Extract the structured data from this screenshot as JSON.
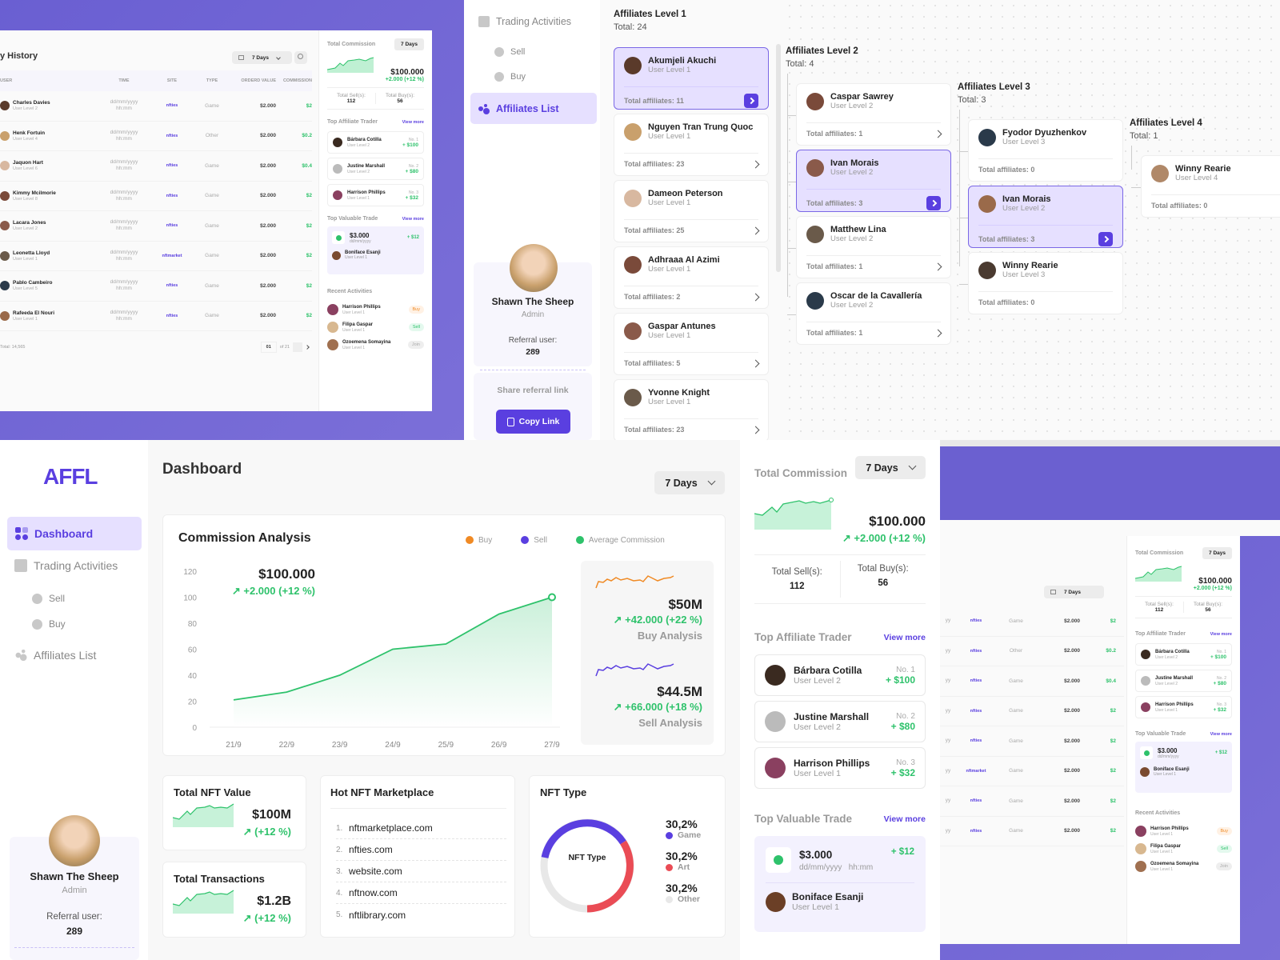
{
  "colors": {
    "accent": "#5a3fe0",
    "green": "#2ec26b",
    "orange": "#f08a24",
    "red": "#ea4c55",
    "bg_purple": "#6b60d0"
  },
  "history": {
    "title": "y History",
    "range": "7 Days",
    "columns": [
      "USER",
      "TIME",
      "SITE",
      "TYPE",
      "ORDERD VALUE",
      "COMMISSION"
    ],
    "rows": [
      {
        "name": "Charles Davies",
        "level": "User Level 2",
        "date": "dd/mm/yyyy",
        "time": "hh:mm",
        "site": "nfties",
        "type": "Game",
        "value": "$2.000",
        "commission": "$2"
      },
      {
        "name": "Henk Fortuin",
        "level": "User Level 4",
        "date": "dd/mm/yyyy",
        "time": "hh:mm",
        "site": "nfties",
        "type": "Other",
        "value": "$2.000",
        "commission": "$0.2"
      },
      {
        "name": "Jaquon Hart",
        "level": "User Level 6",
        "date": "dd/mm/yyyy",
        "time": "hh:mm",
        "site": "nfties",
        "type": "Game",
        "value": "$2.000",
        "commission": "$0.4"
      },
      {
        "name": "Kimmy Mcilmorie",
        "level": "User Level 8",
        "date": "dd/mm/yyyy",
        "time": "hh:mm",
        "site": "nfties",
        "type": "Game",
        "value": "$2.000",
        "commission": "$2"
      },
      {
        "name": "Lacara Jones",
        "level": "User Level 2",
        "date": "dd/mm/yyyy",
        "time": "hh:mm",
        "site": "nfties",
        "type": "Game",
        "value": "$2.000",
        "commission": "$2"
      },
      {
        "name": "Leonetta Lloyd",
        "level": "User Level 1",
        "date": "dd/mm/yyyy",
        "time": "hh:mm",
        "site": "nftmarket",
        "type": "Game",
        "value": "$2.000",
        "commission": "$2"
      },
      {
        "name": "Pablo Cambeiro",
        "level": "User Level 5",
        "date": "dd/mm/yyyy",
        "time": "hh:mm",
        "site": "nfties",
        "type": "Game",
        "value": "$2.000",
        "commission": "$2"
      },
      {
        "name": "Rafeeda El Nouri",
        "level": "User Level 1",
        "date": "dd/mm/yyyy",
        "time": "hh:mm",
        "site": "nfties",
        "type": "Game",
        "value": "$2.000",
        "commission": "$2"
      }
    ],
    "total": "Total: 14,565",
    "page": "01",
    "of_pages": "of 21"
  },
  "commission": {
    "title": "Total Commission",
    "range": "7 Days",
    "value": "$100.000",
    "change": "+2.000 (+12 %)",
    "sell_label": "Total Sell(s):",
    "sell_value": "112",
    "buy_label": "Total Buy(s):",
    "buy_value": "56"
  },
  "top_traders": {
    "title": "Top Affiliate Trader",
    "view_more": "View more",
    "items": [
      {
        "name": "Bárbara Cotilla",
        "level": "User Level 2",
        "rank": "No. 1",
        "amount": "+ $100"
      },
      {
        "name": "Justine Marshall",
        "level": "User Level 2",
        "rank": "No. 2",
        "amount": "+ $80"
      },
      {
        "name": "Harrison Phillips",
        "level": "User Level 1",
        "rank": "No. 3",
        "amount": "+ $32"
      }
    ]
  },
  "valuable_trade": {
    "title": "Top Valuable Trade",
    "view_more": "View more",
    "amount": "$3.000",
    "date": "dd/mm/yyyy",
    "time": "hh:mm",
    "gain": "+ $12",
    "user_name": "Boniface Esanji",
    "user_level": "User Level 1"
  },
  "recent": {
    "title": "Recent Activities",
    "items": [
      {
        "name": "Harrison Phillips",
        "level": "User Level 1",
        "badge": "Buy"
      },
      {
        "name": "Filipa Gaspar",
        "level": "User Level 1",
        "badge": "Sell"
      },
      {
        "name": "Ozoemena Somayina",
        "level": "User Level 1",
        "badge": "Join"
      }
    ]
  },
  "nav": {
    "logo": "AFFL",
    "dashboard": "Dashboard",
    "trading": "Trading Activities",
    "sell": "Sell",
    "buy": "Buy",
    "affiliates": "Affiliates List"
  },
  "profile": {
    "name": "Shawn The Sheep",
    "role": "Admin",
    "referral_label": "Referral user:",
    "referral_value": "289",
    "share_label": "Share referral link",
    "copy_button": "Copy Link"
  },
  "affiliates": {
    "levels": [
      {
        "title": "Affiliates Level 1",
        "total": "Total: 24",
        "items": [
          {
            "name": "Akumjeli Akuchi",
            "level": "User Level 1",
            "total": "Total affiliates: 11",
            "selected": true
          },
          {
            "name": "Nguyen Tran Trung Quoc",
            "level": "User Level 1",
            "total": "Total affiliates: 23"
          },
          {
            "name": "Dameon Peterson",
            "level": "User Level 1",
            "total": "Total affiliates: 25"
          },
          {
            "name": "Adhraaa Al Azimi",
            "level": "User Level 1",
            "total": "Total affiliates: 2"
          },
          {
            "name": "Gaspar Antunes",
            "level": "User Level 1",
            "total": "Total affiliates: 5"
          },
          {
            "name": "Yvonne Knight",
            "level": "User Level 1",
            "total": "Total affiliates: 23"
          }
        ]
      },
      {
        "title": "Affiliates Level 2",
        "total": "Total: 4",
        "items": [
          {
            "name": "Caspar Sawrey",
            "level": "User Level 2",
            "total": "Total affiliates: 1"
          },
          {
            "name": "Ivan Morais",
            "level": "User Level 2",
            "total": "Total affiliates: 3",
            "selected": true
          },
          {
            "name": "Matthew Lina",
            "level": "User Level 2",
            "total": "Total affiliates: 1"
          },
          {
            "name": "Oscar de la Cavallería",
            "level": "User Level 2",
            "total": "Total affiliates: 1"
          }
        ]
      },
      {
        "title": "Affiliates Level 3",
        "total": "Total: 3",
        "items": [
          {
            "name": "Fyodor Dyuzhenkov",
            "level": "User Level 3",
            "total": "Total affiliates: 0"
          },
          {
            "name": "Ivan Morais",
            "level": "User Level 2",
            "total": "Total affiliates: 3",
            "selected": true
          },
          {
            "name": "Winny Rearie",
            "level": "User Level 3",
            "total": "Total affiliates: 0"
          }
        ]
      },
      {
        "title": "Affiliates Level 4",
        "total": "Total: 1",
        "items": [
          {
            "name": "Winny Rearie",
            "level": "User Level 4",
            "total": "Total affiliates: 0"
          }
        ]
      }
    ]
  },
  "dashboard": {
    "title": "Dashboard",
    "range": "7 Days",
    "analysis": {
      "title": "Commission Analysis",
      "value": "$100.000",
      "change": "+2.000 (+12 %)",
      "legend": [
        "Buy",
        "Sell",
        "Average Commission"
      ],
      "buy_value": "$50M",
      "buy_change": "+42.000 (+22 %)",
      "buy_label": "Buy Analysis",
      "sell_value": "$44.5M",
      "sell_change": "+66.000 (+18 %)",
      "sell_label": "Sell Analysis"
    },
    "nft_value": {
      "title": "Total NFT Value",
      "value": "$100M",
      "change": "(+12 %)"
    },
    "transactions": {
      "title": "Total Transactions",
      "value": "$1.2B",
      "change": "(+12 %)"
    },
    "marketplace": {
      "title": "Hot NFT Marketplace",
      "items": [
        "nftmarketplace.com",
        "nfties.com",
        "website.com",
        "nftnow.com",
        "nftlibrary.com"
      ]
    },
    "nft_type": {
      "title": "NFT Type",
      "center": "NFT Type",
      "items": [
        {
          "pct": "30,2%",
          "label": "Game",
          "color": "#5a3fe0"
        },
        {
          "pct": "30,2%",
          "label": "Art",
          "color": "#ea4c55"
        },
        {
          "pct": "30,2%",
          "label": "Other",
          "color": "#e8e8e8"
        }
      ]
    }
  },
  "chart_data": {
    "type": "line",
    "title": "Commission Analysis",
    "x": [
      "21/9",
      "22/9",
      "23/9",
      "24/9",
      "25/9",
      "26/9",
      "27/9"
    ],
    "series": [
      {
        "name": "Average Commission",
        "values": [
          21,
          27,
          40,
          60,
          64,
          87,
          100
        ]
      }
    ],
    "ylim": [
      0,
      120
    ],
    "yticks": [
      0,
      20,
      40,
      60,
      80,
      100,
      120
    ],
    "legend": [
      "Buy",
      "Sell",
      "Average Commission"
    ],
    "grid": false
  }
}
